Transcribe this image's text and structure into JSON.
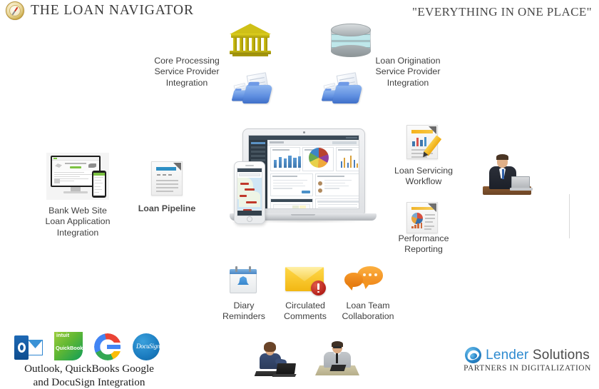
{
  "header": {
    "brand": "THE LOAN NAVIGATOR",
    "tagline": "\"EVERYTHING IN ONE PLACE\"",
    "logo_icon": "compass-icon",
    "brand_color": "#3b3b3b"
  },
  "nodes": {
    "core_processing": {
      "label": "Core Processing\nService Provider\nIntegration",
      "icons": [
        "bank-building-icon",
        "folder-exchange-icon"
      ],
      "icon_color": "#cfc017"
    },
    "loan_origination": {
      "label": "Loan Origination\nService Provider\nIntegration",
      "icons": [
        "database-cylinder-icon",
        "folder-exchange-icon"
      ],
      "icon_color": "#b9bfc2"
    },
    "bank_website": {
      "label": "Bank Web Site\nLoan Application\nIntegration",
      "icons": [
        "monitor-icon",
        "mobile-phone-icon"
      ]
    },
    "loan_pipeline": {
      "label": "Loan Pipeline",
      "icons": [
        "document-cursor-icon"
      ],
      "accent_color": "#2e8fc4"
    },
    "loan_servicing": {
      "label": "Loan Servicing\nWorkflow",
      "icons": [
        "document-chart-pencil-icon"
      ],
      "accent_color": "#f5b21a"
    },
    "performance_reporting": {
      "label": "Performance\nReporting",
      "icons": [
        "document-pie-chart-icon"
      ],
      "accent_color": "#f0b429"
    },
    "diary_reminders": {
      "label": "Diary\nReminders",
      "icons": [
        "calendar-bell-icon"
      ],
      "accent_color": "#4a86c4"
    },
    "circulated_comments": {
      "label": "Circulated\nComments",
      "icons": [
        "envelope-alert-icon"
      ],
      "accent_color": "#f2b713"
    },
    "loan_team": {
      "label": "Loan Team\nCollaboration",
      "icons": [
        "speech-bubbles-icon"
      ],
      "accent_color": "#f08a1c"
    },
    "integrations": {
      "label": "Outlook, QuickBooks Google\nand DocuSign Integration",
      "logos": [
        {
          "name": "outlook-logo",
          "text": "",
          "color": "#0d4c8e"
        },
        {
          "name": "quickbooks-logo",
          "text": "QuickBooks",
          "sup": "intuit",
          "color": "#0f9d58"
        },
        {
          "name": "google-logo",
          "text": "G",
          "color": "#4285f4"
        },
        {
          "name": "docusign-logo",
          "text": "DocuSign",
          "color": "#1b7cc0"
        }
      ]
    }
  },
  "center": {
    "device": "laptop-and-phone-mockup",
    "dashboard_panels": [
      "bar-chart-panel",
      "pie-chart-panel",
      "scatter-chart-panel",
      "map-panel",
      "comments-panel",
      "calendar-panel",
      "table-panel"
    ]
  },
  "people": {
    "businessman_right": "businessman-at-desk-photo",
    "woman_laptop": "woman-at-laptop-photo",
    "man_desk": "man-writing-at-desk-photo"
  },
  "footer": {
    "company": {
      "name_part1": "Lender",
      "name_part2": "Solutions",
      "tagline": "PARTNERS IN DIGITALIZATION",
      "mark": "swirl-logo-icon",
      "brand_blue": "#2f8bd0",
      "brand_gray": "#4a4a4a"
    }
  }
}
